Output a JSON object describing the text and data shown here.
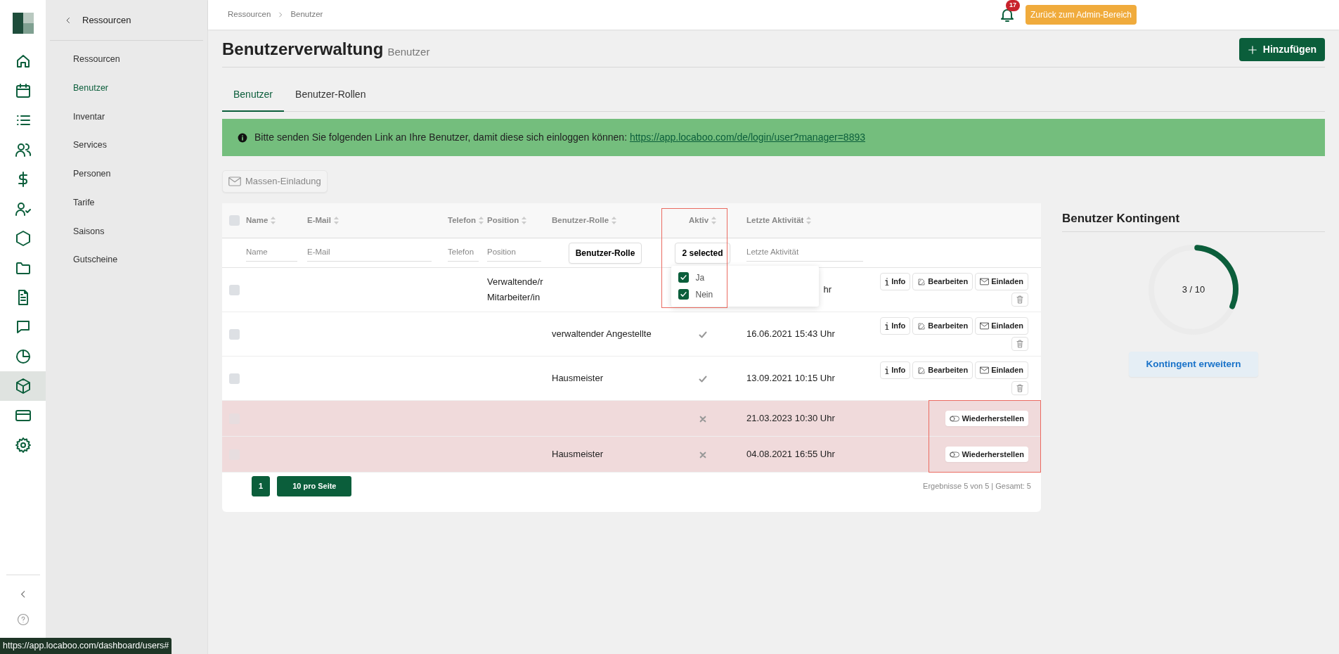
{
  "rail": [
    {
      "selected": false
    },
    {
      "selected": false
    },
    {
      "selected": false
    },
    {
      "selected": false
    },
    {
      "selected": false
    },
    {
      "selected": false
    },
    {
      "selected": false
    },
    {
      "selected": false
    },
    {
      "selected": false
    },
    {
      "selected": false
    },
    {
      "selected": false
    },
    {
      "selected": true
    },
    {
      "selected": false
    },
    {
      "selected": false
    }
  ],
  "subnav": {
    "back_label": "Ressourcen",
    "items": [
      {
        "label": "Ressourcen",
        "selected": false
      },
      {
        "label": "Benutzer",
        "selected": true
      },
      {
        "label": "Inventar",
        "selected": false
      },
      {
        "label": "Services",
        "selected": false
      },
      {
        "label": "Personen",
        "selected": false
      },
      {
        "label": "Tarife",
        "selected": false
      },
      {
        "label": "Saisons",
        "selected": false
      },
      {
        "label": "Gutscheine",
        "selected": false
      }
    ]
  },
  "breadcrumb": [
    "Ressourcen",
    "Benutzer"
  ],
  "notifications": {
    "count": "17"
  },
  "admin_button": "Zurück zum Admin-Bereich",
  "page": {
    "title": "Benutzerverwaltung",
    "subtitle": "Benutzer"
  },
  "add_button": "Hinzufügen",
  "tabs": [
    {
      "label": "Benutzer",
      "selected": true
    },
    {
      "label": "Benutzer-Rollen",
      "selected": false
    }
  ],
  "alert": {
    "text": "Bitte senden Sie folgenden Link an Ihre Benutzer, damit diese sich einloggen können:",
    "link": "https://app.locaboo.com/de/login/user?manager=8893"
  },
  "bulk_invite": {
    "label": "Massen-Einladung",
    "disabled": true
  },
  "table": {
    "select_all": false,
    "columns": [
      {
        "kind": "name",
        "label": "Name",
        "filter": {
          "kind": "text",
          "placeholder": "Name"
        }
      },
      {
        "kind": "email",
        "label": "E-Mail",
        "filter": {
          "kind": "text",
          "placeholder": "E-Mail"
        }
      },
      {
        "kind": "phone",
        "label": "Telefon",
        "filter": {
          "kind": "text",
          "placeholder": "Telefon"
        }
      },
      {
        "kind": "position",
        "label": "Position",
        "filter": {
          "kind": "text",
          "placeholder": "Position"
        }
      },
      {
        "kind": "role",
        "label": "Benutzer-Rolle",
        "filter": {
          "kind": "select",
          "label": "Benutzer-Rolle"
        }
      },
      {
        "kind": "active",
        "label": "Aktiv",
        "filter": {
          "kind": "multiselect",
          "label": "2 selected",
          "expanded": true,
          "options": [
            {
              "label": "Ja",
              "checked": true
            },
            {
              "label": "Nein",
              "checked": true
            }
          ]
        }
      },
      {
        "kind": "last_activity",
        "label": "Letzte Aktivität",
        "filter": {
          "kind": "text",
          "placeholder": "Letzte Aktivität"
        }
      }
    ],
    "rows": [
      {
        "selected": false,
        "deleted": false,
        "position": "Verwaltende/r Mitarbeiter/in",
        "last_activity": "hr",
        "actions": [
          {
            "kind": "info",
            "label": "Info"
          },
          {
            "kind": "edit",
            "label": "Bearbeiten"
          },
          {
            "kind": "invite",
            "label": "Einladen"
          },
          {
            "kind": "delete"
          }
        ]
      },
      {
        "selected": false,
        "deleted": false,
        "role": "verwaltender Angestellte",
        "active": true,
        "last_activity": "16.06.2021 15:43 Uhr",
        "actions": [
          {
            "kind": "info",
            "label": "Info"
          },
          {
            "kind": "edit",
            "label": "Bearbeiten"
          },
          {
            "kind": "invite",
            "label": "Einladen"
          },
          {
            "kind": "delete"
          }
        ]
      },
      {
        "selected": false,
        "deleted": false,
        "role": "Hausmeister",
        "active": true,
        "last_activity": "13.09.2021 10:15 Uhr",
        "actions": [
          {
            "kind": "info",
            "label": "Info"
          },
          {
            "kind": "edit",
            "label": "Bearbeiten"
          },
          {
            "kind": "invite",
            "label": "Einladen"
          },
          {
            "kind": "delete"
          }
        ]
      },
      {
        "selected": false,
        "deleted": true,
        "active": false,
        "last_activity": "21.03.2023 10:30 Uhr",
        "actions": [
          {
            "kind": "restore",
            "label": "Wiederherstellen"
          }
        ]
      },
      {
        "selected": false,
        "deleted": true,
        "role": "Hausmeister",
        "active": false,
        "last_activity": "04.08.2021 16:55 Uhr",
        "actions": [
          {
            "kind": "restore",
            "label": "Wiederherstellen"
          }
        ]
      }
    ],
    "highlights": {
      "active_column": true,
      "deleted_actions": true
    },
    "pagination": {
      "pages": [
        {
          "label": "1",
          "selected": true
        }
      ],
      "page_size": "10 pro Seite",
      "summary": "Ergebnisse 5 von 5 | Gesamt: 5"
    }
  },
  "quota": {
    "title": "Benutzer Kontingent",
    "reading": "3 / 10",
    "level": 0.3,
    "button": "Kontingent erweitern"
  },
  "status_url": "https://app.locaboo.com/dashboard/users#"
}
